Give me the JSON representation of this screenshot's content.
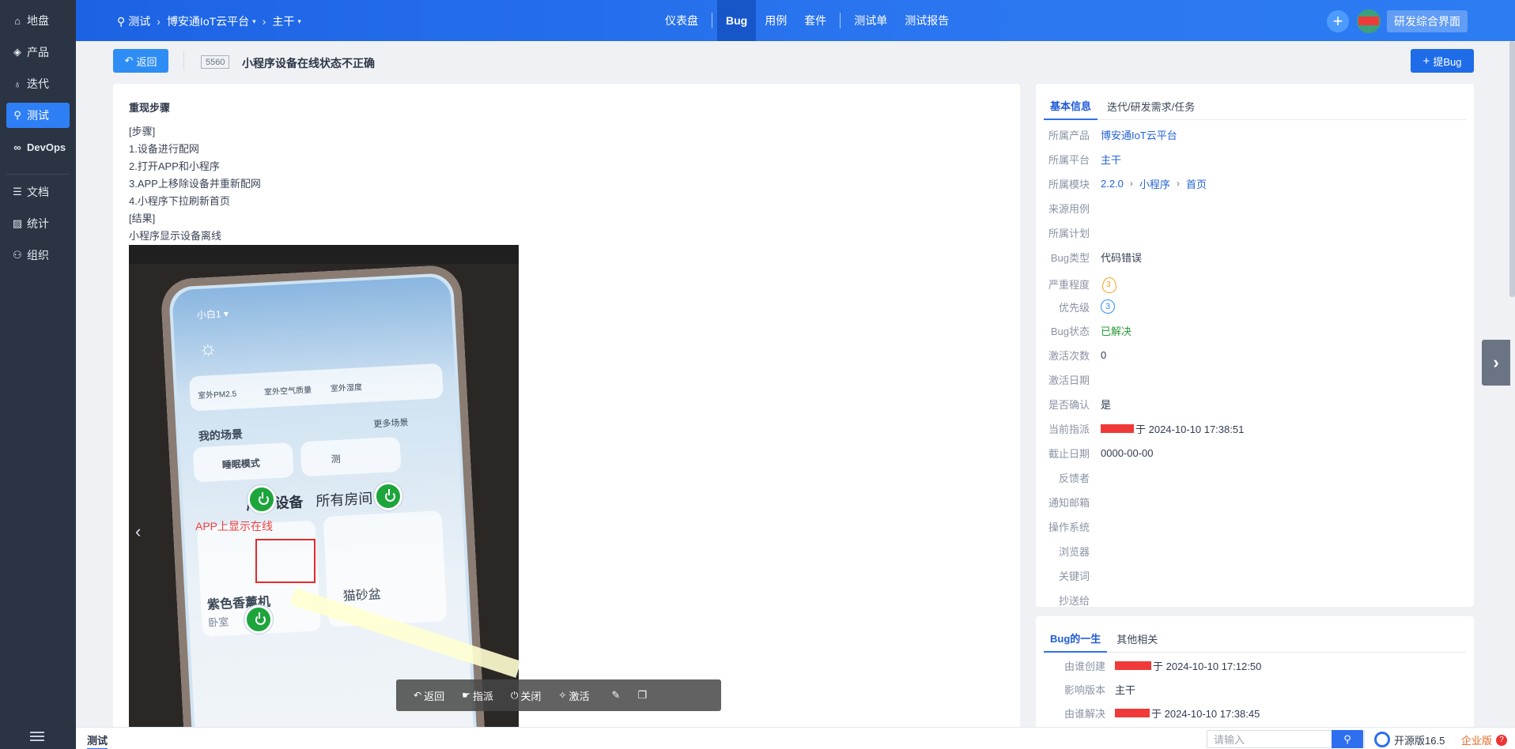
{
  "sidebar": {
    "items": [
      {
        "label": "地盘",
        "icon": "home-icon"
      },
      {
        "label": "产品",
        "icon": "product-icon"
      },
      {
        "label": "迭代",
        "icon": "iteration-icon"
      },
      {
        "label": "测试",
        "icon": "test-icon"
      },
      {
        "label": "DevOps",
        "icon": "devops-icon"
      },
      {
        "label": "文档",
        "icon": "doc-icon"
      },
      {
        "label": "统计",
        "icon": "stats-icon"
      },
      {
        "label": "组织",
        "icon": "org-icon"
      }
    ],
    "active": "测试"
  },
  "header": {
    "module": "测试",
    "product": "博安通IoT云平台",
    "branch": "主干",
    "nav": [
      "仪表盘",
      "Bug",
      "用例",
      "套件",
      "测试单",
      "测试报告"
    ],
    "active_nav": "Bug",
    "suite_button": "研发综合界面"
  },
  "titlebar": {
    "back_label": "返回",
    "bug_id": "5560",
    "bug_title": "小程序设备在线状态不正确",
    "report_bug_label": "提Bug"
  },
  "content": {
    "section_title": "重现步骤",
    "steps": [
      "[步骤]",
      "1.设备进行配网",
      "2.打开APP和小程序",
      "3.APP上移除设备并重新配网",
      "4.小程序下拉刷新首页",
      "[结果]",
      "小程序显示设备离线"
    ],
    "screenshot": {
      "user": "小白1",
      "labels": [
        "室外PM2.5",
        "室外空气质量",
        "室外湿度"
      ],
      "my_scenes": "我的场景",
      "more_scenes": "更多场景",
      "scene_1": "睡眠模式",
      "scene_2": "测",
      "all_devices": "所有设备",
      "all_rooms": "所有房间",
      "annotation": "APP上显示在线",
      "device_1": "紫色香薰机",
      "device_1_room": "卧室",
      "device_2": "猫砂盆"
    }
  },
  "actions": [
    "返回",
    "指派",
    "关闭",
    "激活"
  ],
  "basic_info": {
    "tabs": [
      "基本信息",
      "迭代/研发需求/任务"
    ],
    "rows": [
      {
        "label": "所属产品",
        "value": "博安通IoT云平台",
        "type": "link"
      },
      {
        "label": "所属平台",
        "value": "主干",
        "type": "link"
      },
      {
        "label": "所属模块",
        "value": "",
        "type": "module"
      },
      {
        "label": "来源用例",
        "value": "",
        "type": "text"
      },
      {
        "label": "所属计划",
        "value": "",
        "type": "text"
      },
      {
        "label": "Bug类型",
        "value": "代码错误",
        "type": "text"
      },
      {
        "label": "严重程度",
        "value": "3",
        "type": "severity"
      },
      {
        "label": "优先级",
        "value": "3",
        "type": "priority"
      },
      {
        "label": "Bug状态",
        "value": "已解决",
        "type": "status"
      },
      {
        "label": "激活次数",
        "value": "0",
        "type": "text"
      },
      {
        "label": "激活日期",
        "value": "",
        "type": "text"
      },
      {
        "label": "是否确认",
        "value": "是",
        "type": "text"
      },
      {
        "label": "当前指派",
        "value": "于 2024-10-10 17:38:51",
        "type": "redacted"
      },
      {
        "label": "截止日期",
        "value": "0000-00-00",
        "type": "text"
      },
      {
        "label": "反馈者",
        "value": "",
        "type": "text"
      },
      {
        "label": "通知邮箱",
        "value": "",
        "type": "text"
      },
      {
        "label": "操作系统",
        "value": "",
        "type": "text"
      },
      {
        "label": "浏览器",
        "value": "",
        "type": "text"
      },
      {
        "label": "关键词",
        "value": "",
        "type": "text"
      },
      {
        "label": "抄送给",
        "value": "",
        "type": "text"
      }
    ],
    "module_path": [
      "2.2.0",
      "小程序",
      "首页"
    ]
  },
  "lifecycle": {
    "tabs": [
      "Bug的一生",
      "其他相关"
    ],
    "rows": [
      {
        "label": "由谁创建",
        "value": "于 2024-10-10 17:12:50"
      },
      {
        "label": "影响版本",
        "value": "主干"
      },
      {
        "label": "由谁解决",
        "value": "于 2024-10-10 17:38:45"
      }
    ]
  },
  "footer": {
    "tab": "测试",
    "search_placeholder": "请输入",
    "version": "开源版16.5",
    "enterprise": "企业版"
  }
}
